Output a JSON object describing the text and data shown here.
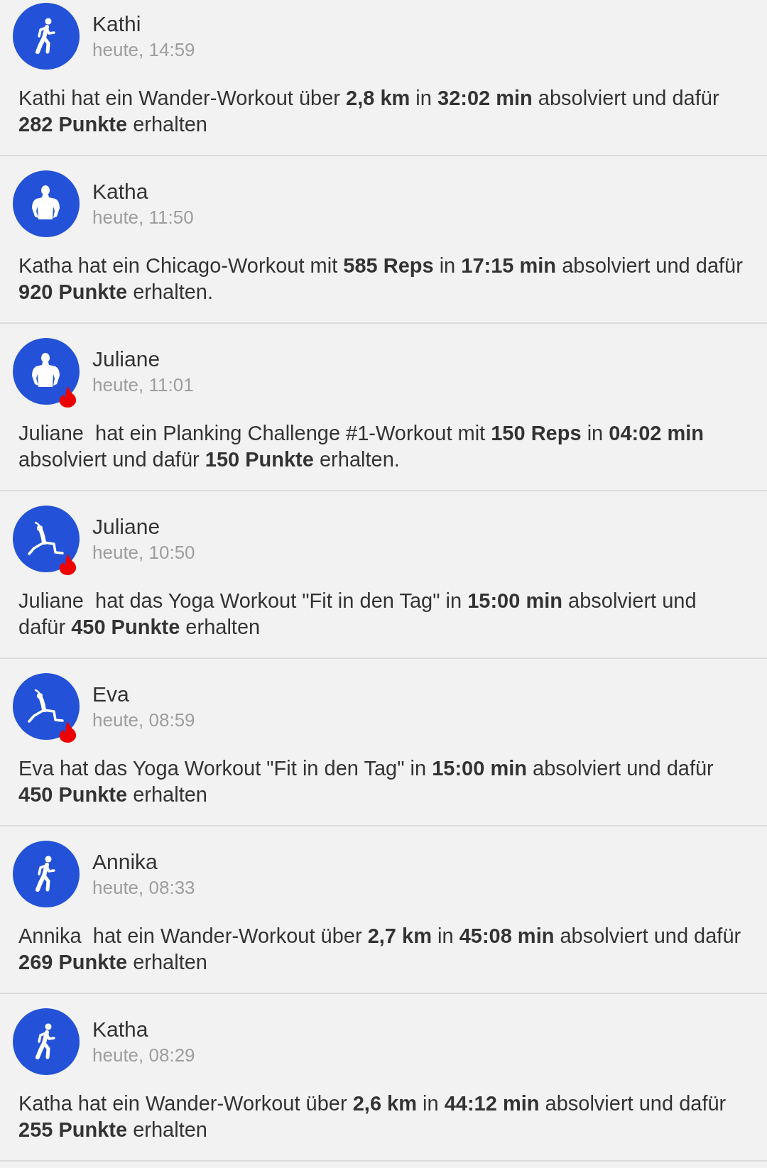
{
  "feed": [
    {
      "name": "Kathi",
      "time": "heute, 14:59",
      "kind": "walk",
      "flame": false,
      "text": "Kathi hat ein Wander-Workout über **2,8 km** in **32:02 min** absolviert und dafür **282 Punkte** erhalten"
    },
    {
      "name": "Katha",
      "time": "heute, 11:50",
      "kind": "strength",
      "flame": false,
      "text": "Katha hat ein Chicago-Workout mit **585 Reps** in **17:15 min** absolviert und dafür **920 Punkte** erhalten."
    },
    {
      "name": "Juliane",
      "time": "heute, 11:01",
      "kind": "strength",
      "flame": true,
      "text": "Juliane  hat ein Planking Challenge #1-Workout mit **150 Reps** in **04:02 min** absolviert und dafür **150 Punkte** erhalten."
    },
    {
      "name": "Juliane",
      "time": "heute, 10:50",
      "kind": "yoga",
      "flame": true,
      "text": "Juliane  hat das Yoga Workout \"Fit in den Tag\" in **15:00 min** absolviert und dafür **450 Punkte** erhalten"
    },
    {
      "name": "Eva",
      "time": "heute, 08:59",
      "kind": "yoga",
      "flame": true,
      "text": "Eva hat das Yoga Workout \"Fit in den Tag\" in **15:00 min** absolviert und dafür **450 Punkte** erhalten"
    },
    {
      "name": "Annika",
      "time": "heute, 08:33",
      "kind": "walk",
      "flame": false,
      "text": "Annika  hat ein Wander-Workout über **2,7 km** in **45:08 min** absolviert und dafür **269 Punkte** erhalten"
    },
    {
      "name": "Katha",
      "time": "heute, 08:29",
      "kind": "walk",
      "flame": false,
      "text": "Katha hat ein Wander-Workout über **2,6 km** in **44:12 min** absolviert und dafür **255 Punkte** erhalten"
    }
  ]
}
